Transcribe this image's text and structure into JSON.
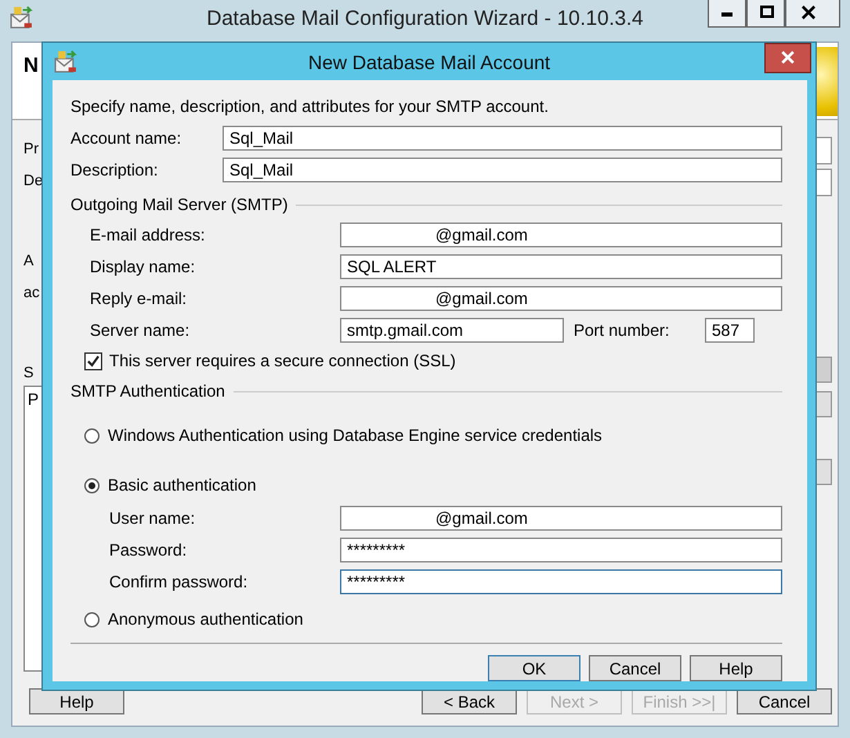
{
  "wizard": {
    "title": "Database Mail Configuration Wizard - 10.10.3.4",
    "heading": "N",
    "side_texts": [
      {
        "text": "Pr",
        "kind": "line"
      },
      {
        "text": "De",
        "kind": "line"
      },
      {
        "text": "A",
        "kind": "para"
      },
      {
        "text": "ac",
        "kind": "line"
      },
      {
        "text": "S",
        "kind": "para"
      }
    ],
    "list_item": "P",
    "buttons": [
      {
        "label": "Help",
        "disabled": false,
        "kind": "left"
      },
      {
        "label": "< Back",
        "disabled": false,
        "kind": "right"
      },
      {
        "label": "Next >",
        "disabled": true,
        "kind": "right"
      },
      {
        "label": "Finish >>|",
        "disabled": true,
        "kind": "right"
      },
      {
        "label": "Cancel",
        "disabled": false,
        "kind": "right"
      }
    ]
  },
  "dialog": {
    "title": "New Database Mail Account",
    "intro": "Specify name, description, and attributes for your SMTP account.",
    "fields": [
      {
        "label": "Account name:",
        "value": "Sql_Mail"
      },
      {
        "label": "Description:",
        "value": "Sql_Mail"
      }
    ],
    "smtp": {
      "title": "Outgoing Mail Server (SMTP)",
      "fields": [
        {
          "label": "E-mail address:",
          "value": "@gmail.com",
          "redacted": true
        },
        {
          "label": "Display name:",
          "value": "SQL ALERT",
          "redacted": false
        },
        {
          "label": "Reply e-mail:",
          "value": "@gmail.com",
          "redacted": true
        }
      ],
      "server": {
        "label": "Server name:",
        "value": "smtp.gmail.com"
      },
      "port": {
        "label": "Port number:",
        "value": "587"
      },
      "ssl": {
        "label": "This server requires a secure connection (SSL)",
        "checked": true
      }
    },
    "auth": {
      "title": "SMTP Authentication",
      "options": [
        {
          "label": "Windows Authentication using Database Engine service credentials",
          "selected": false
        },
        {
          "label": "Basic authentication",
          "selected": true,
          "fields": [
            {
              "label": "User name:",
              "value": "@gmail.com",
              "redacted": true,
              "focused": false
            },
            {
              "label": "Password:",
              "value": "*********",
              "redacted": false,
              "focused": false
            },
            {
              "label": "Confirm password:",
              "value": "*********",
              "redacted": false,
              "focused": true
            }
          ]
        },
        {
          "label": "Anonymous authentication",
          "selected": false
        }
      ]
    },
    "buttons": [
      {
        "label": "OK",
        "default": true
      },
      {
        "label": "Cancel",
        "default": false
      },
      {
        "label": "Help",
        "default": false
      }
    ]
  }
}
